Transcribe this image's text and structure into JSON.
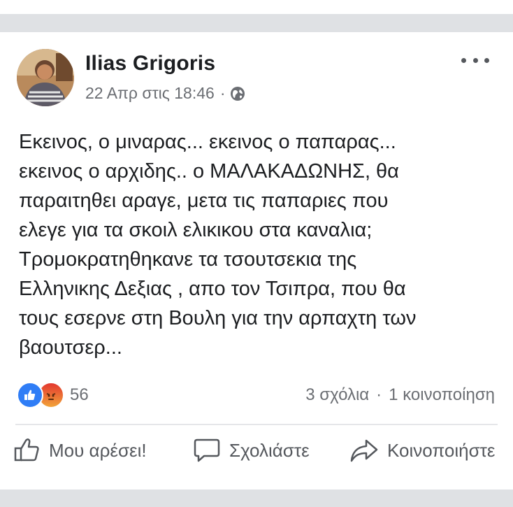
{
  "post": {
    "author": "Ilias Grigoris",
    "timestamp": "22 Απρ στις 18:46",
    "separator": "·",
    "privacy_icon": "globe-icon",
    "more_icon": "more-dots-icon",
    "body_lines": [
      "Εκεινος, ο μιναρας... εκεινος ο παπαρας...",
      "εκεινος ο αρχιδης.. ο ΜΑΛΑΚΑΔΩΝΗΣ, θα",
      "παραιτηθει αραγε, μετα τις παπαριες που",
      "ελεγε για τα σκοιλ ελικικου στα καναλια;",
      "Τρομοκρατηθηκανε τα τσουτσεκια της",
      "Ελληνικης Δεξιας , απο τον Τσιπρα, που θα",
      "τους εσερνε στη Βουλη για την αρπαχτη των",
      "βαουτσερ..."
    ]
  },
  "engagement": {
    "reaction_icons": [
      "like-reaction-icon",
      "angry-reaction-icon"
    ],
    "reaction_count": "56",
    "comments": "3 σχόλια",
    "separator": "·",
    "shares": "1 κοινοποίηση"
  },
  "actions": {
    "like_label": "Μου αρέσει!",
    "comment_label": "Σχολιάστε",
    "share_label": "Κοινοποιήστε"
  },
  "colors": {
    "background": "#dfe1e4",
    "card": "#ffffff",
    "text": "#1c1e21",
    "secondary_text": "#6b6e73",
    "like_blue": "#2f7df6",
    "angry_red": "#e3372f"
  }
}
